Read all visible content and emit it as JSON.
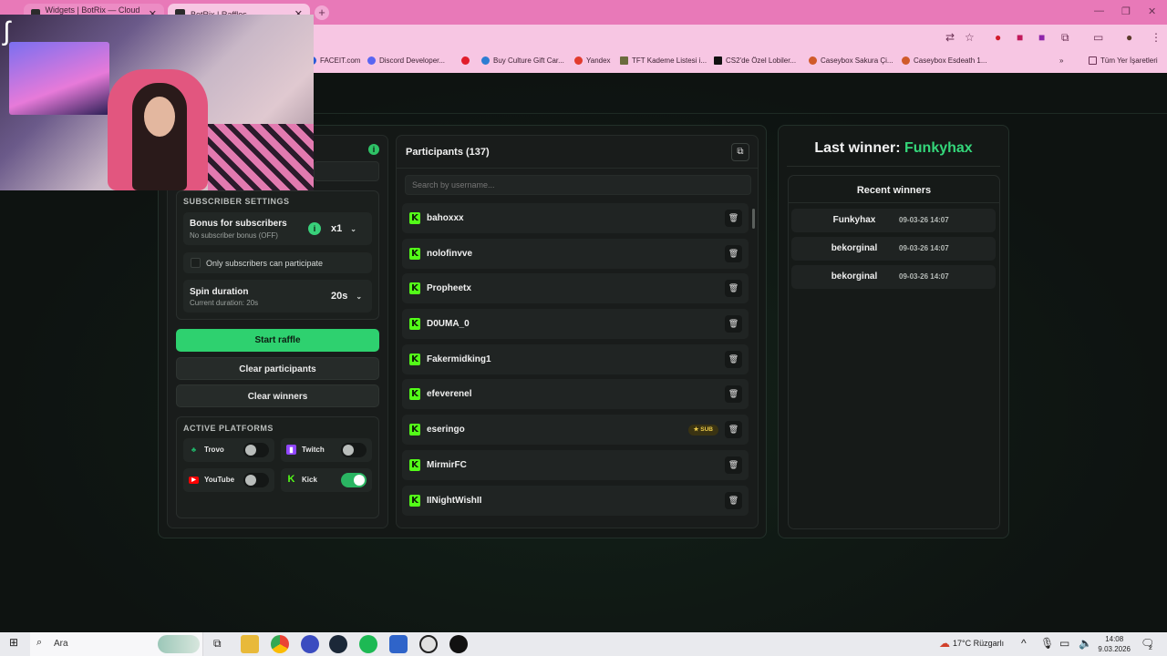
{
  "browser": {
    "tabs": [
      {
        "label": "Widgets | BotRix — Cloud Stre..."
      },
      {
        "label": "BotRix | Raffles"
      }
    ],
    "bookmarks": [
      {
        "label": "FACEIT.com",
        "color": "#2a5bd7"
      },
      {
        "label": "Discord Developer...",
        "color": "#5865f2"
      },
      {
        "label": "",
        "color": "#e11d2b"
      },
      {
        "label": "Buy Culture Gift Car...",
        "color": "#2d7dd2"
      },
      {
        "label": "Yandex",
        "color": "#e23b2d"
      },
      {
        "label": "TFT Kademe Listesi i...",
        "color": "#6b6b3d"
      },
      {
        "label": "CS2'de Özel Lobiler...",
        "color": "#111111"
      },
      {
        "label": "Caseybox Sakura Çi...",
        "color": "#d05a2a"
      },
      {
        "label": "Caseybox Esdeath 1...",
        "color": "#d05a2a"
      }
    ],
    "all_bookmarks": "Tüm Yer İşaretleri"
  },
  "settings": {
    "subscriber_title": "Subscriber settings",
    "bonus_title": "Bonus for subscribers",
    "bonus_sub": "No subscriber bonus (OFF)",
    "bonus_value": "x1",
    "only_subs": "Only subscribers can participate",
    "spin_title": "Spin duration",
    "spin_sub": "Current duration: 20s",
    "spin_value": "20s"
  },
  "buttons": {
    "start": "Start raffle",
    "clear_participants": "Clear participants",
    "clear_winners": "Clear winners"
  },
  "platforms": {
    "title": "Active platforms",
    "items": [
      {
        "label": "Trovo",
        "on": false,
        "color": "#1fb86b"
      },
      {
        "label": "Twitch",
        "on": false,
        "color": "#9146ff"
      },
      {
        "label": "YouTube",
        "on": false,
        "color": "#ff0000"
      },
      {
        "label": "Kick",
        "on": true,
        "color": "#53fc18"
      }
    ]
  },
  "participants": {
    "title": "Participants (137)",
    "search_placeholder": "Search by username...",
    "list": [
      {
        "name": "bahoxxx",
        "sub": ""
      },
      {
        "name": "nolofinvve",
        "sub": ""
      },
      {
        "name": "Propheetx",
        "sub": ""
      },
      {
        "name": "D0UMA_0",
        "sub": ""
      },
      {
        "name": "Fakermidking1",
        "sub": ""
      },
      {
        "name": "efeverenel",
        "sub": ""
      },
      {
        "name": "eseringo",
        "sub": "★ SUB"
      },
      {
        "name": "MirmirFC",
        "sub": ""
      },
      {
        "name": "IINightWishII",
        "sub": ""
      }
    ]
  },
  "winners": {
    "last_label": "Last winner:",
    "last_name": "Funkyhax",
    "recent_title": "Recent winners",
    "list": [
      {
        "name": "Funkyhax",
        "date": "09-03-26 14:07"
      },
      {
        "name": "bekorginal",
        "date": "09-03-26 14:07"
      },
      {
        "name": "bekorginal",
        "date": "09-03-26 14:07"
      }
    ]
  },
  "taskbar": {
    "search": "Ara",
    "weather": "17°C  Rüzgarlı",
    "time": "14:08",
    "date": "9.03.2026",
    "notif": "2"
  }
}
